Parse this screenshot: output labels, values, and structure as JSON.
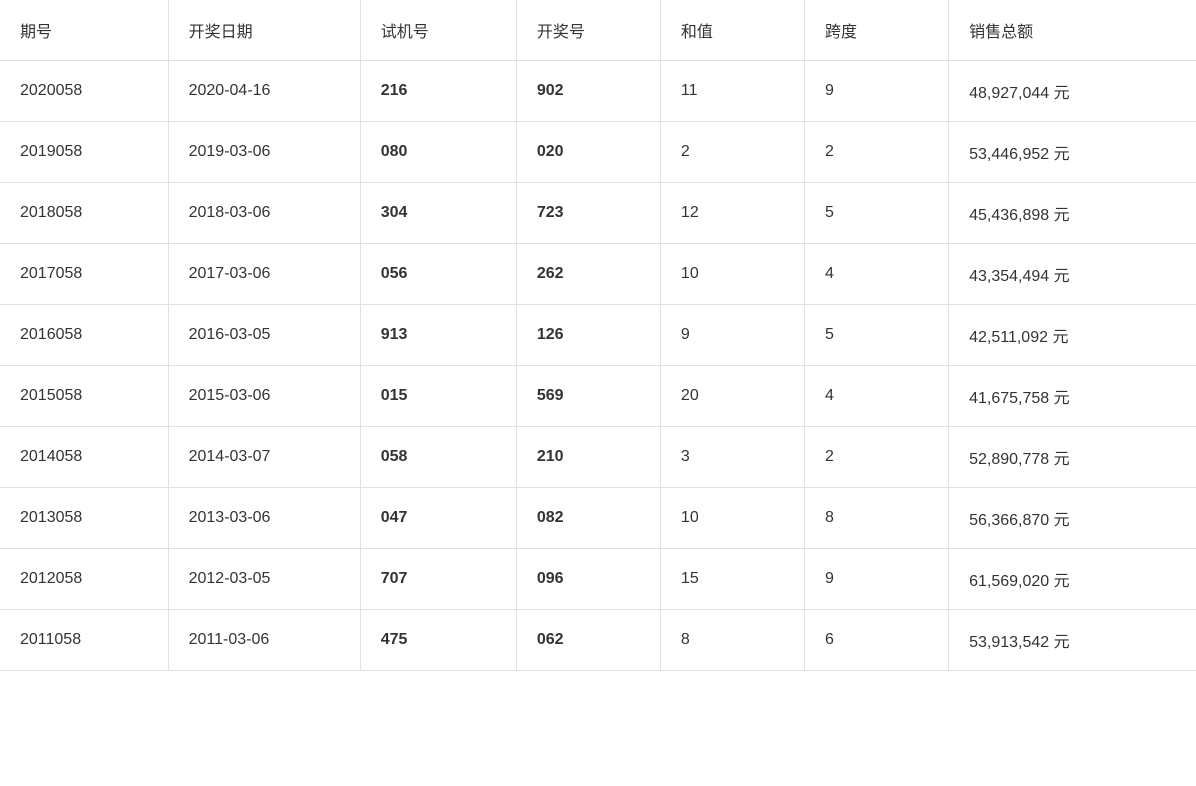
{
  "table": {
    "headers": [
      "期号",
      "开奖日期",
      "试机号",
      "开奖号",
      "和值",
      "跨度",
      "销售总额"
    ],
    "rows": [
      {
        "period": "2020058",
        "date": "2020-04-16",
        "trial": "216",
        "winning": "902",
        "sum": "11",
        "span": "9",
        "sales": "48,927,044 元"
      },
      {
        "period": "2019058",
        "date": "2019-03-06",
        "trial": "080",
        "winning": "020",
        "sum": "2",
        "span": "2",
        "sales": "53,446,952 元"
      },
      {
        "period": "2018058",
        "date": "2018-03-06",
        "trial": "304",
        "winning": "723",
        "sum": "12",
        "span": "5",
        "sales": "45,436,898 元"
      },
      {
        "period": "2017058",
        "date": "2017-03-06",
        "trial": "056",
        "winning": "262",
        "sum": "10",
        "span": "4",
        "sales": "43,354,494 元"
      },
      {
        "period": "2016058",
        "date": "2016-03-05",
        "trial": "913",
        "winning": "126",
        "sum": "9",
        "span": "5",
        "sales": "42,511,092 元"
      },
      {
        "period": "2015058",
        "date": "2015-03-06",
        "trial": "015",
        "winning": "569",
        "sum": "20",
        "span": "4",
        "sales": "41,675,758 元"
      },
      {
        "period": "2014058",
        "date": "2014-03-07",
        "trial": "058",
        "winning": "210",
        "sum": "3",
        "span": "2",
        "sales": "52,890,778 元"
      },
      {
        "period": "2013058",
        "date": "2013-03-06",
        "trial": "047",
        "winning": "082",
        "sum": "10",
        "span": "8",
        "sales": "56,366,870 元"
      },
      {
        "period": "2012058",
        "date": "2012-03-05",
        "trial": "707",
        "winning": "096",
        "sum": "15",
        "span": "9",
        "sales": "61,569,020 元"
      },
      {
        "period": "2011058",
        "date": "2011-03-06",
        "trial": "475",
        "winning": "062",
        "sum": "8",
        "span": "6",
        "sales": "53,913,542 元"
      }
    ]
  }
}
